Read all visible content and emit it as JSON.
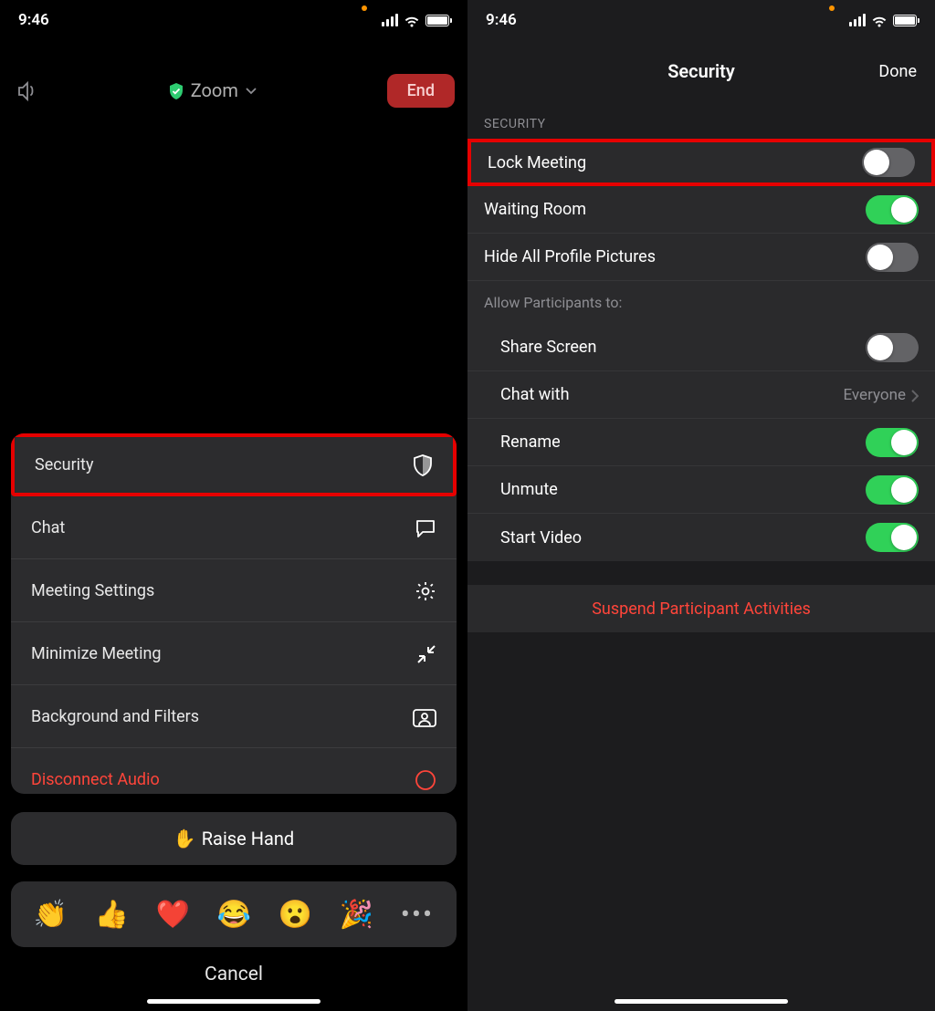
{
  "status": {
    "time": "9:46"
  },
  "left": {
    "title": "Zoom",
    "end": "End",
    "menu": {
      "security": "Security",
      "chat": "Chat",
      "settings": "Meeting Settings",
      "minimize": "Minimize Meeting",
      "background": "Background and Filters",
      "disconnect": "Disconnect Audio"
    },
    "raise_hand": "Raise Hand",
    "emojis": [
      "👏",
      "👍",
      "❤️",
      "😂",
      "😮",
      "🎉"
    ],
    "cancel": "Cancel"
  },
  "right": {
    "title": "Security",
    "done": "Done",
    "section_header": "SECURITY",
    "rows": {
      "lock": "Lock Meeting",
      "waiting": "Waiting Room",
      "hide_pics": "Hide All Profile Pictures",
      "allow_label": "Allow Participants to:",
      "share": "Share Screen",
      "chat_with": "Chat with",
      "chat_with_value": "Everyone",
      "rename": "Rename",
      "unmute": "Unmute",
      "start_video": "Start Video"
    },
    "suspend": "Suspend Participant Activities"
  }
}
